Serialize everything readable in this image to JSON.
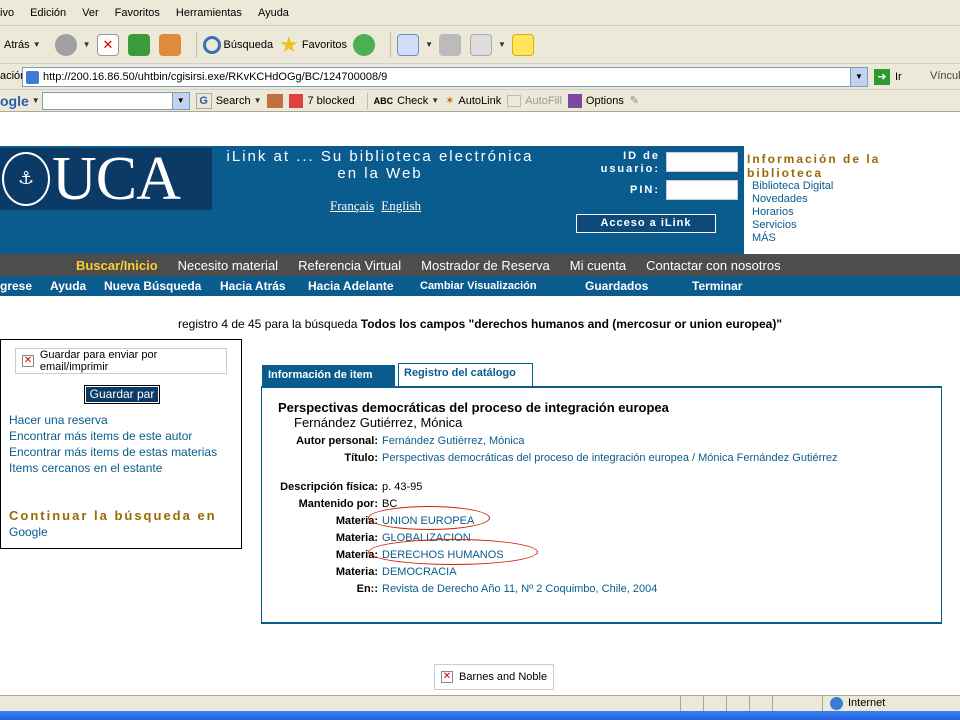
{
  "browser": {
    "menu": [
      "ivo",
      "Edición",
      "Ver",
      "Favoritos",
      "Herramientas",
      "Ayuda"
    ],
    "toolbar": {
      "back": "Atrás",
      "search": "Búsqueda",
      "favorites": "Favoritos"
    },
    "address": {
      "label": "ación",
      "url": "http://200.16.86.50/uhtbin/cgisirsi.exe/RKvKCHdOGg/BC/124700008/9",
      "go": "Ir",
      "links": "Víncul"
    },
    "googlebar": {
      "logo": "ogle",
      "search": "Search",
      "blocked": "7 blocked",
      "check": "Check",
      "autolink": "AutoLink",
      "autofill": "AutoFill",
      "options": "Options"
    },
    "status": {
      "zone": "Internet"
    }
  },
  "header": {
    "logo": "UCA",
    "title": "iLink at ... Su biblioteca electrónica en la Web",
    "lang_fr": "Français",
    "lang_en": "English",
    "user_label": "ID de usuario:",
    "pin_label": "PIN:",
    "login_button": "Acceso a iLink",
    "info_title": "Información de la biblioteca",
    "info_links": [
      "Biblioteca Digital",
      "Novedades",
      "Horarios",
      "Servicios",
      "MÁS"
    ]
  },
  "nav1": [
    "Buscar/Inicio",
    "Necesito material",
    "Referencia Virtual",
    "Mostrador de Reserva",
    "Mi cuenta",
    "Contactar con nosotros"
  ],
  "nav2": [
    "grese",
    "Ayuda",
    "Nueva Búsqueda",
    "Hacia Atrás",
    "Hacia Adelante",
    "Cambiar Visualización",
    "Guardados",
    "Terminar"
  ],
  "search_summary": {
    "prefix": "registro 4 de 45 para la búsqueda",
    "query": "Todos los campos \"derechos humanos and (mercosur or union europea)\""
  },
  "sidebar": {
    "save_checkbox": "Guardar para enviar por email/imprimir",
    "save_button": "Guardar par",
    "links": [
      "Hacer una reserva",
      "Encontrar más items de este autor",
      "Encontrar más items de estas materias",
      "Items cercanos en el estante"
    ],
    "continue": "Continuar la búsqueda en",
    "google": "Google"
  },
  "tabs": {
    "info": "Información de item",
    "catalog": "Registro del catálogo"
  },
  "record": {
    "title": "Perspectivas democráticas del proceso de integración europea",
    "author_line": "Fernández Gutiérrez, Mónica",
    "fields": [
      {
        "label": "Autor personal:",
        "value": "Fernández Gutiérrez, Mónica"
      },
      {
        "label": "Título:",
        "value": "Perspectivas democráticas del proceso de integración europea / Mónica Fernández Gutiérrez"
      },
      {
        "label": "Descripción física:",
        "value": "p. 43-95"
      },
      {
        "label": "Mantenido por:",
        "value": "BC"
      },
      {
        "label": "Materia:",
        "value": "UNION EUROPEA"
      },
      {
        "label": "Materia:",
        "value": "GLOBALIZACION"
      },
      {
        "label": "Materia:",
        "value": "DERECHOS HUMANOS"
      },
      {
        "label": "Materia:",
        "value": "DEMOCRACIA"
      },
      {
        "label": "En::",
        "value": "Revista de Derecho Año 11, Nº 2 Coquimbo, Chile, 2004"
      }
    ]
  },
  "barnes": "Barnes and Noble",
  "colors": {
    "brand_blue": "#0a5c8f",
    "dark_blue": "#0c3a66",
    "gold": "#9a6a00",
    "nav_gray": "#4d4d4d",
    "annotation_red": "#cc2200"
  }
}
